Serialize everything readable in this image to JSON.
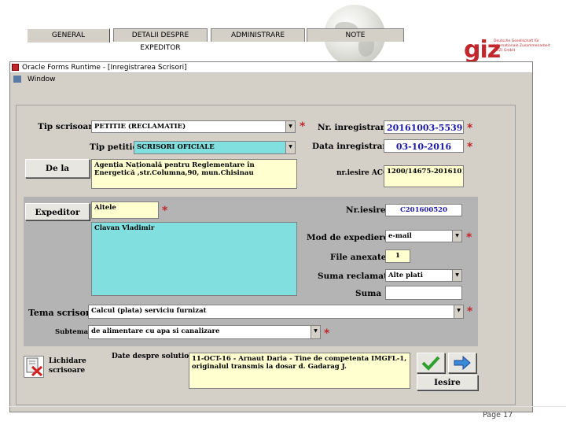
{
  "slide": {
    "logo": "giz",
    "logo_sub": "Deutsche Gesellschaft für Internationale Zusammenarbeit (GIZ) GmbH",
    "page": "Page 17"
  },
  "window": {
    "title": "Oracle Forms Runtime - [Inregistrarea Scrisori]",
    "menu": "Window"
  },
  "tabs": [
    "GENERAL",
    "DETALII DESPRE EXPEDITOR",
    "ADMINISTRARE",
    "NOTE"
  ],
  "form": {
    "tip_scrisoare": {
      "label": "Tip scrisoare",
      "value": "PETITIE (RECLAMATIE)"
    },
    "tip_petitie": {
      "label": "Tip petitie",
      "value": "SCRISORI OFICIALE"
    },
    "de_la": {
      "label": "De la",
      "value": "Agenția Națională pentru Reglementare în Energetică ,str.Columna,90, mun.Chisinau"
    },
    "nr_inregistrare": {
      "label": "Nr. inregistrare",
      "value": "20161003-5539"
    },
    "data_inregistrare": {
      "label": "Data inregistrare",
      "value": "03-10-2016"
    },
    "nr_iesire_acc": {
      "label": "nr.iesire ACC",
      "value": "1200/14675-20161011"
    },
    "expeditor": {
      "label": "Expeditor",
      "value": "Altele"
    },
    "expeditor_name": "Clavan Vladimir",
    "nr_iesire": {
      "label": "Nr.iesire",
      "value": "C201600520"
    },
    "mod_expediere": {
      "label": "Mod de expediere",
      "value": "e-mail"
    },
    "file_anexate": {
      "label": "File anexate",
      "value": "1"
    },
    "suma_reclamata": {
      "label": "Suma reclamata",
      "value": "Alte plati"
    },
    "suma": {
      "label": "Suma",
      "value": ""
    },
    "tema_scrisorii": {
      "label": "Tema scrisorii",
      "value": "Calcul (plata) serviciu furnizat"
    },
    "subtema": {
      "label": "Subtema",
      "value": "de alimentare cu apa si canalizare"
    },
    "lichidare": {
      "label_line1": "Lichidare",
      "label_line2": "scrisoare"
    },
    "date_solutionare": {
      "label": "Date despre solutionare",
      "value": "11-OCT-16 - Arnaut Daria - Tine de competenta IMGFL-1, originalul transmis la dosar d. Gadarag J."
    },
    "iesire_button": "Iesire"
  },
  "colors": {
    "cyan": "#82dfe0",
    "yellow": "#ffffcf",
    "required": "#c0282d",
    "window_bg": "#d4d0c8"
  },
  "icons": [
    "check-icon",
    "arrow-right-icon",
    "delete-doc-icon",
    "globe-icon"
  ]
}
